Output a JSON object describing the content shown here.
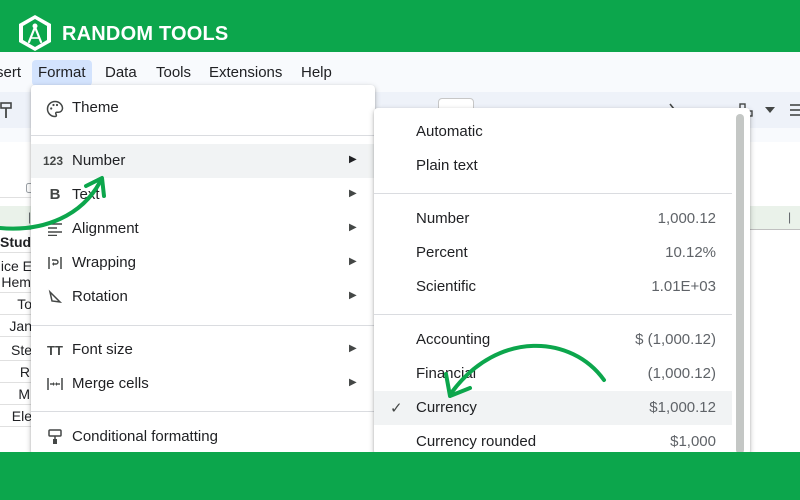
{
  "brand": {
    "name": "RANDOM TOOLS",
    "color": "#0ca64c"
  },
  "menubar": {
    "items": [
      "sert",
      "Format",
      "Data",
      "Tools",
      "Extensions",
      "Help"
    ],
    "active": "Format"
  },
  "sheet_cells": [
    "Stude",
    "ice E",
    "Hemi",
    "To",
    "Jan",
    "Ste",
    "R",
    "M",
    "Ele"
  ],
  "format_menu": {
    "items": [
      {
        "icon": "palette-icon",
        "label": "Theme"
      },
      {
        "icon": "number-format-icon",
        "icon_text": "123",
        "label": "Number"
      },
      {
        "icon": "bold-icon",
        "icon_text": "B",
        "label": "Text"
      },
      {
        "icon": "align-left-icon",
        "label": "Alignment"
      },
      {
        "icon": "wrapping-icon",
        "label": "Wrapping"
      },
      {
        "icon": "rotation-icon",
        "label": "Rotation"
      },
      {
        "icon": "font-size-icon",
        "icon_text": "TT",
        "label": "Font size"
      },
      {
        "icon": "merge-cells-icon",
        "label": "Merge cells"
      },
      {
        "icon": "conditional-formatting-icon",
        "label": "Conditional formatting"
      }
    ],
    "highlighted": "Number"
  },
  "number_menu": {
    "items": [
      {
        "label": "Automatic",
        "example": ""
      },
      {
        "label": "Plain text",
        "example": ""
      },
      {
        "label": "Number",
        "example": "1,000.12"
      },
      {
        "label": "Percent",
        "example": "10.12%"
      },
      {
        "label": "Scientific",
        "example": "1.01E+03"
      },
      {
        "label": "Accounting",
        "example": "$ (1,000.12)"
      },
      {
        "label": "Financial",
        "example": "(1,000.12)"
      },
      {
        "label": "Currency",
        "example": "$1,000.12"
      },
      {
        "label": "Currency rounded",
        "example": "$1,000"
      }
    ],
    "selected": "Currency",
    "check_glyph": "✓"
  }
}
